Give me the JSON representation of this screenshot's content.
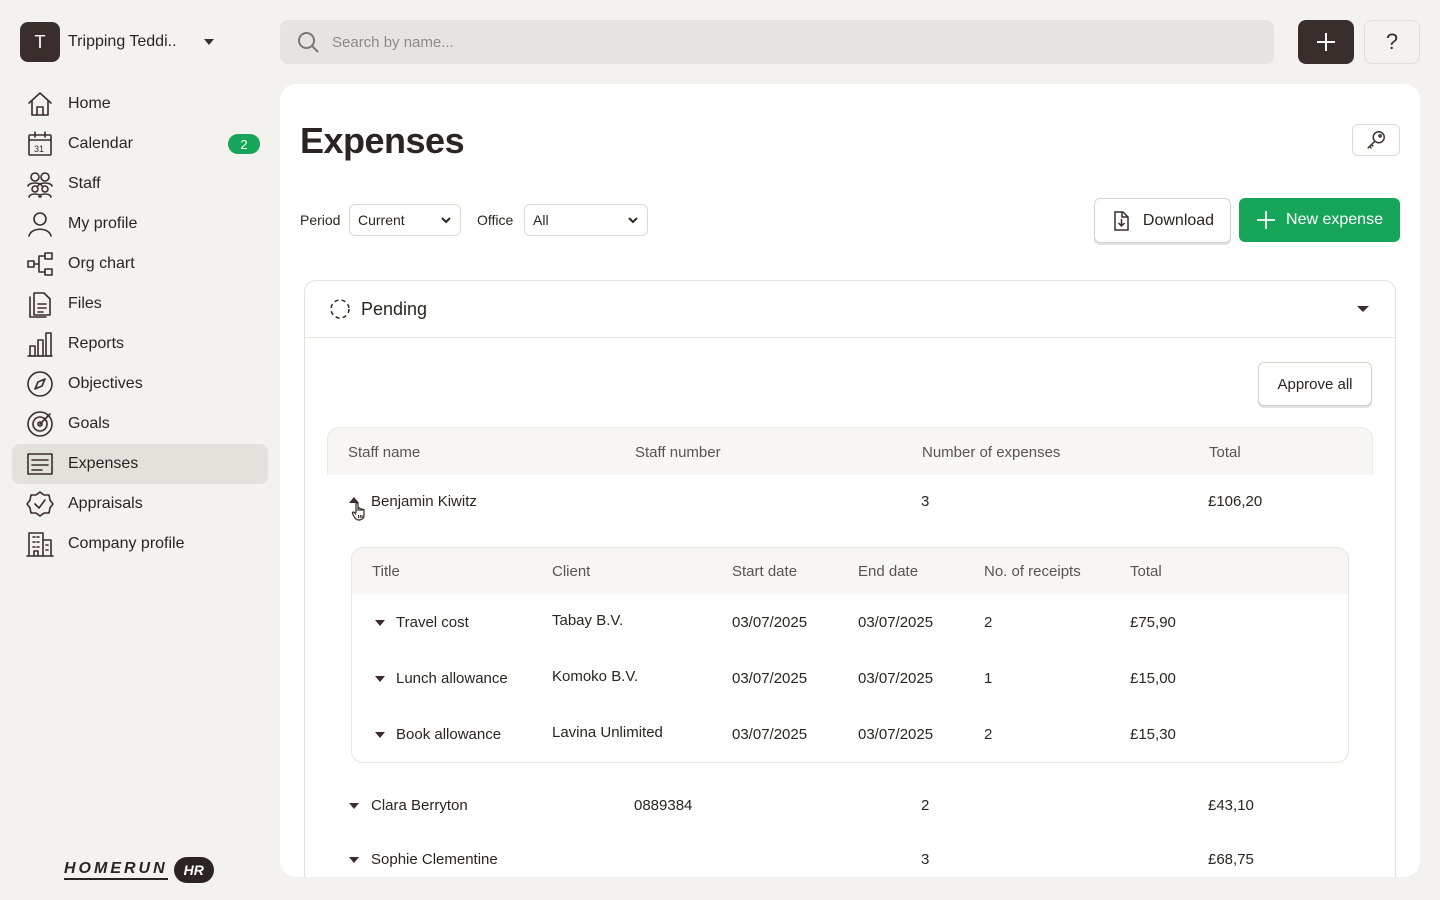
{
  "org": {
    "initial": "T",
    "name": "Tripping Teddi.."
  },
  "nav": [
    {
      "label": "Home",
      "icon": "home-icon"
    },
    {
      "label": "Calendar",
      "icon": "calendar-icon",
      "badge": "2",
      "calendar_day": "31"
    },
    {
      "label": "Staff",
      "icon": "staff-icon"
    },
    {
      "label": "My profile",
      "icon": "user-icon"
    },
    {
      "label": "Org chart",
      "icon": "org-chart-icon"
    },
    {
      "label": "Files",
      "icon": "files-icon"
    },
    {
      "label": "Reports",
      "icon": "bar-chart-icon"
    },
    {
      "label": "Objectives",
      "icon": "compass-icon"
    },
    {
      "label": "Goals",
      "icon": "target-icon"
    },
    {
      "label": "Expenses",
      "icon": "receipt-icon",
      "active": true
    },
    {
      "label": "Appraisals",
      "icon": "badge-check-icon"
    },
    {
      "label": "Company profile",
      "icon": "building-icon"
    }
  ],
  "brand": {
    "word": "HOMERUN",
    "pill": "HR"
  },
  "search": {
    "placeholder": "Search by name..."
  },
  "topbar": {
    "help_label": "?"
  },
  "page": {
    "title": "Expenses",
    "filters": {
      "period_label": "Period",
      "period_value": "Current",
      "office_label": "Office",
      "office_value": "All"
    },
    "download_label": "Download",
    "new_expense_label": "New expense"
  },
  "pending": {
    "title": "Pending",
    "approve_all_label": "Approve all",
    "columns": [
      "Staff name",
      "Staff number",
      "Number of expenses",
      "Total"
    ],
    "staff": [
      {
        "name": "Benjamin Kiwitz",
        "number": "",
        "count": "3",
        "total": "£106,20",
        "expanded": true,
        "sub_columns": [
          "Title",
          "Client",
          "Start date",
          "End date",
          "No. of receipts",
          "Total"
        ],
        "expenses": [
          {
            "title": "Travel cost",
            "client": "Tabay B.V.",
            "start": "03/07/2025",
            "end": "03/07/2025",
            "receipts": "2",
            "total": "£75,90"
          },
          {
            "title": "Lunch allowance",
            "client": "Komoko B.V.",
            "start": "03/07/2025",
            "end": "03/07/2025",
            "receipts": "1",
            "total": "£15,00"
          },
          {
            "title": "Book allowance",
            "client": "Lavina Unlimited",
            "start": "03/07/2025",
            "end": "03/07/2025",
            "receipts": "2",
            "total": "£15,30"
          }
        ]
      },
      {
        "name": "Clara Berryton",
        "number": "0889384",
        "count": "2",
        "total": "£43,10"
      },
      {
        "name": "Sophie Clementine",
        "number": "",
        "count": "3",
        "total": "£68,75"
      }
    ]
  }
}
